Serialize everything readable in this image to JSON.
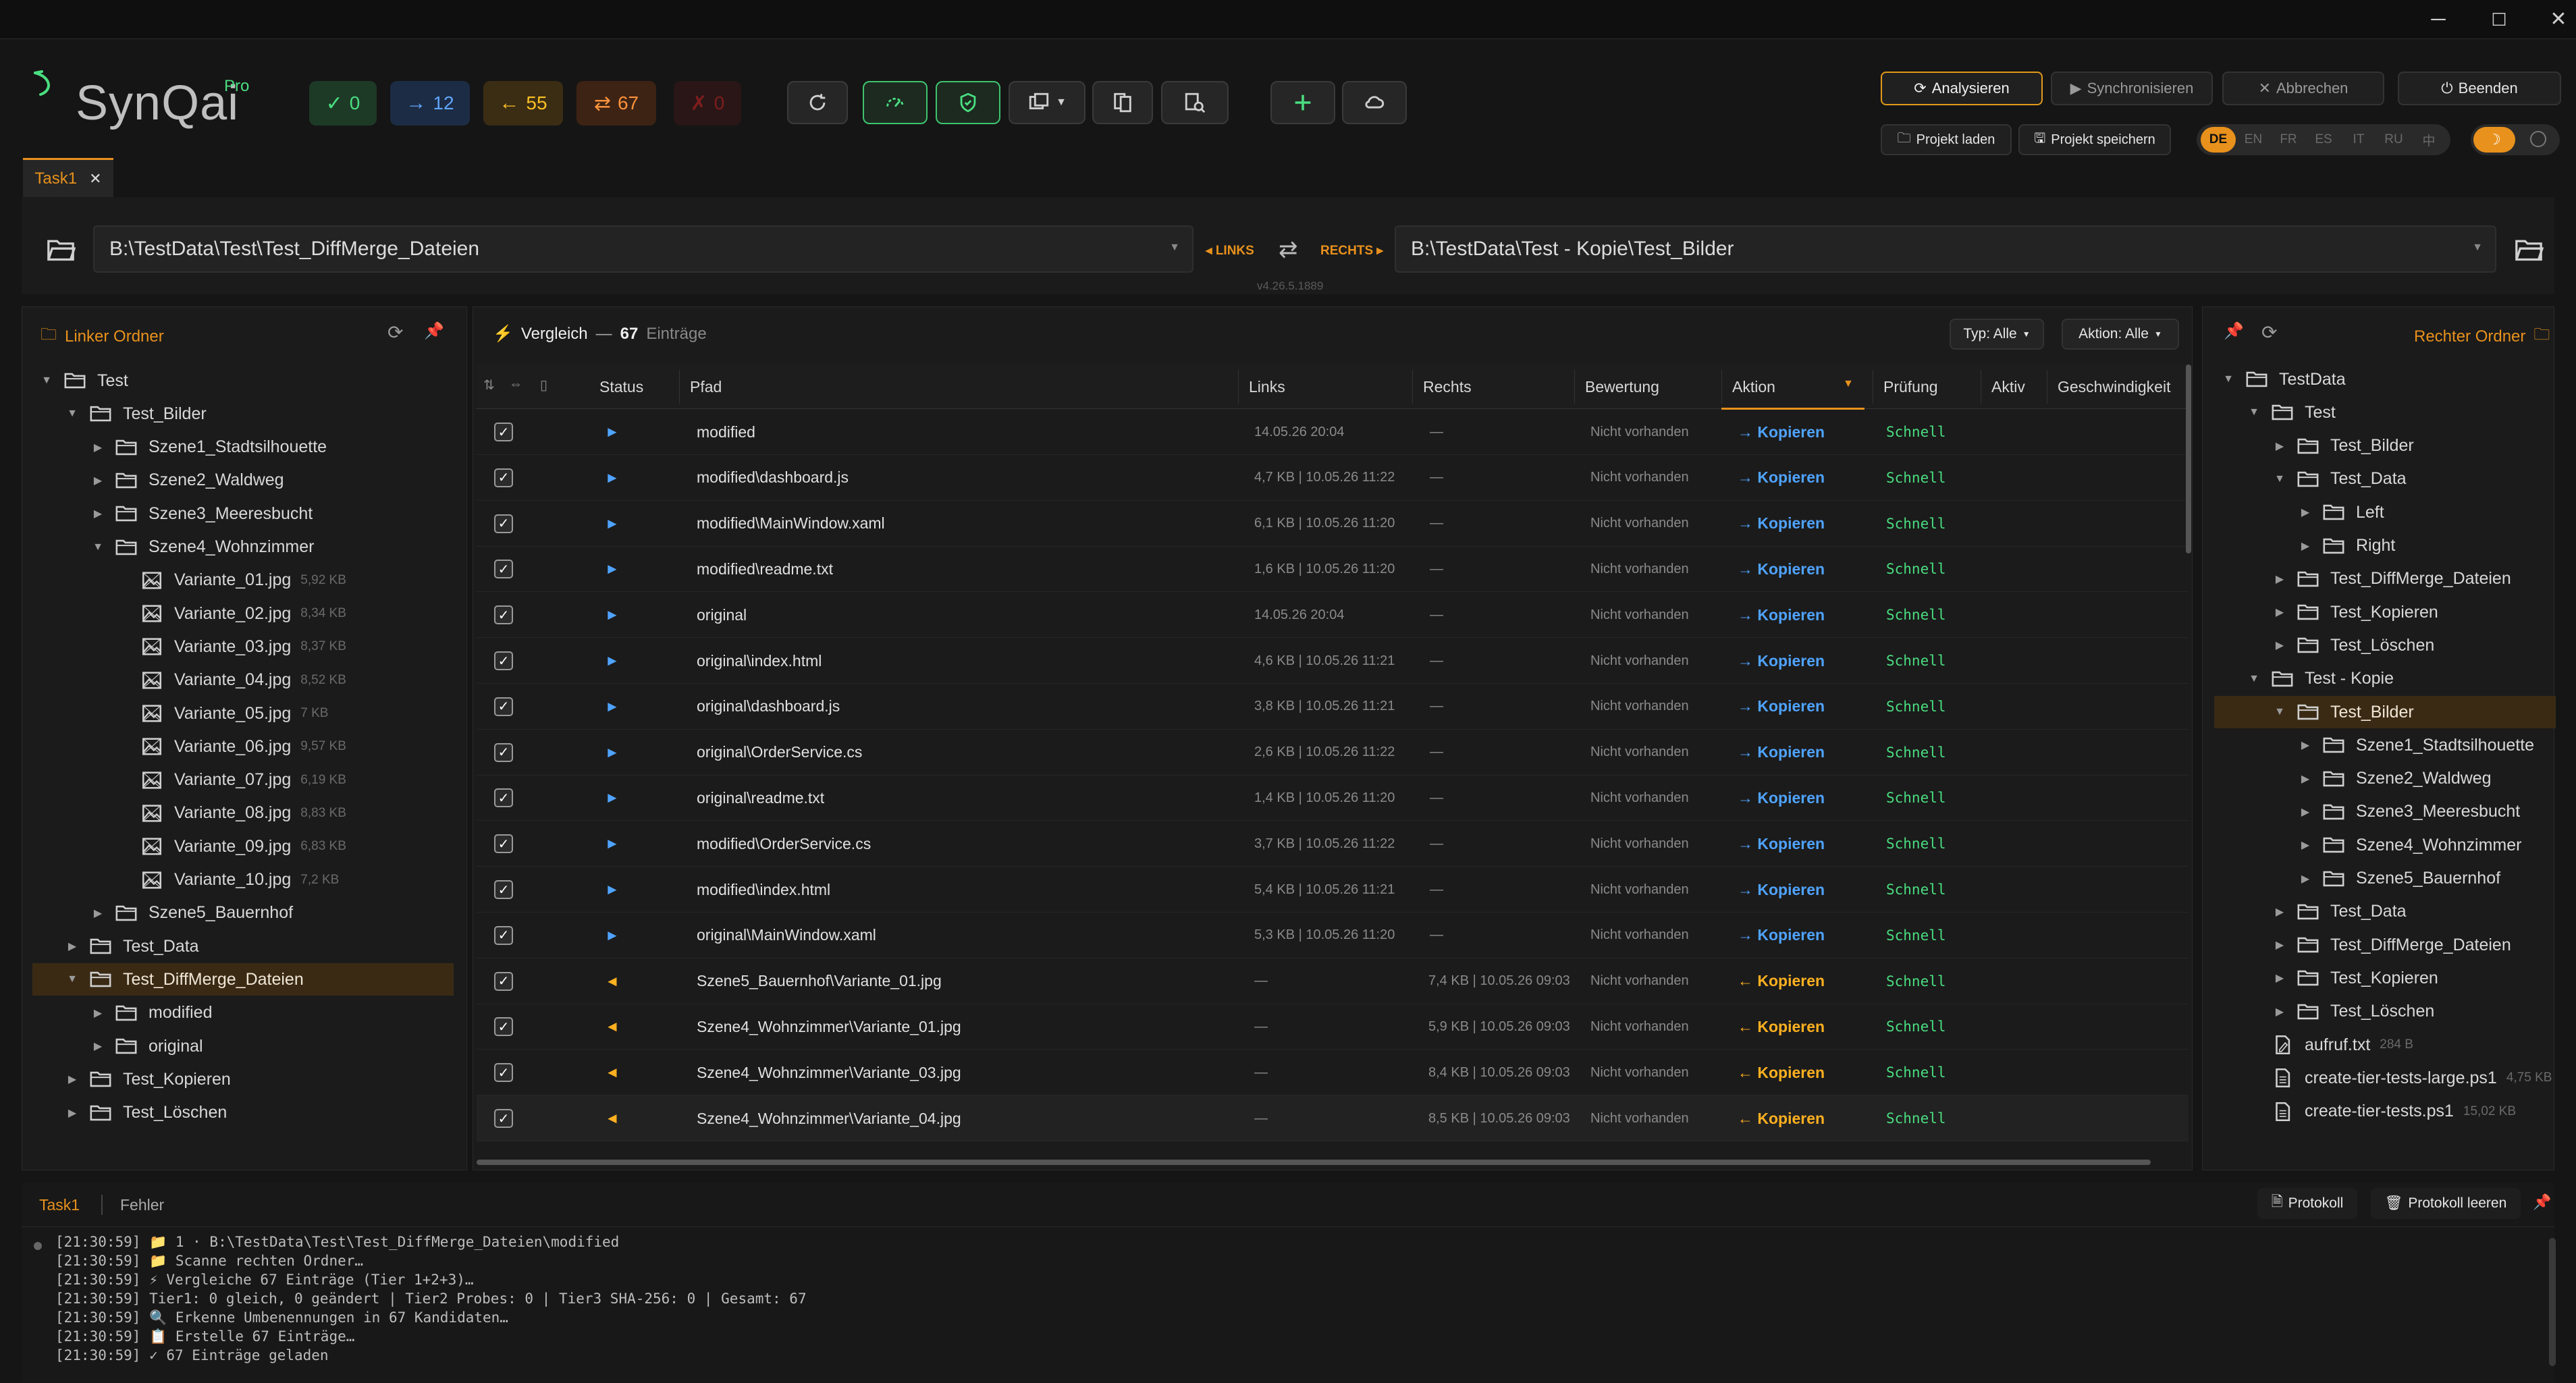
{
  "window": {
    "minimize": "─",
    "maximize": "☐",
    "close": "✕"
  },
  "app": {
    "name": "SynQai",
    "badge": "Pro"
  },
  "counters": [
    {
      "icon": "✓",
      "value": "0",
      "color": "#4ade80",
      "bg": "#1d3a27"
    },
    {
      "icon": "→",
      "value": "12",
      "color": "#60a5fa",
      "bg": "#1c2c44"
    },
    {
      "icon": "←",
      "value": "55",
      "color": "#fbbf24",
      "bg": "#3a2d14"
    },
    {
      "icon": "⇄",
      "value": "67",
      "color": "#fb923c",
      "bg": "#3d2314"
    },
    {
      "icon": "✗",
      "value": "0",
      "color": "#7f1d1d",
      "bg": "#2a1616"
    }
  ],
  "actions": {
    "analyze": "Analysieren",
    "sync": "Synchronisieren",
    "cancel": "Abbrechen",
    "quit": "Beenden",
    "load_project": "Projekt laden",
    "save_project": "Projekt speichern"
  },
  "languages": [
    "DE",
    "EN",
    "FR",
    "ES",
    "IT",
    "RU",
    "中"
  ],
  "active_language": "DE",
  "tab": {
    "label": "Task1",
    "close": "✕"
  },
  "paths": {
    "left": "B:\\TestData\\Test\\Test_DiffMerge_Dateien",
    "right": "B:\\TestData\\Test - Kopie\\Test_Bilder",
    "left_tag": "◂ LINKS",
    "right_tag": "RECHTS ▸",
    "swap": "⇄",
    "version": "v4.26.5.1889"
  },
  "left_panel": {
    "title": "Linker Ordner",
    "tree": [
      {
        "label": "Test",
        "type": "folder",
        "depth": 0,
        "exp": "▼"
      },
      {
        "label": "Test_Bilder",
        "type": "folder",
        "depth": 1,
        "exp": "▼"
      },
      {
        "label": "Szene1_Stadtsilhouette",
        "type": "folder",
        "depth": 2,
        "exp": "▶"
      },
      {
        "label": "Szene2_Waldweg",
        "type": "folder",
        "depth": 2,
        "exp": "▶"
      },
      {
        "label": "Szene3_Meeresbucht",
        "type": "folder",
        "depth": 2,
        "exp": "▶"
      },
      {
        "label": "Szene4_Wohnzimmer",
        "type": "folder",
        "depth": 2,
        "exp": "▼"
      },
      {
        "label": "Variante_01.jpg",
        "type": "image",
        "depth": 3,
        "size": "5,92 KB"
      },
      {
        "label": "Variante_02.jpg",
        "type": "image",
        "depth": 3,
        "size": "8,34 KB"
      },
      {
        "label": "Variante_03.jpg",
        "type": "image",
        "depth": 3,
        "size": "8,37 KB"
      },
      {
        "label": "Variante_04.jpg",
        "type": "image",
        "depth": 3,
        "size": "8,52 KB"
      },
      {
        "label": "Variante_05.jpg",
        "type": "image",
        "depth": 3,
        "size": "7 KB"
      },
      {
        "label": "Variante_06.jpg",
        "type": "image",
        "depth": 3,
        "size": "9,57 KB"
      },
      {
        "label": "Variante_07.jpg",
        "type": "image",
        "depth": 3,
        "size": "6,19 KB"
      },
      {
        "label": "Variante_08.jpg",
        "type": "image",
        "depth": 3,
        "size": "8,83 KB"
      },
      {
        "label": "Variante_09.jpg",
        "type": "image",
        "depth": 3,
        "size": "6,83 KB"
      },
      {
        "label": "Variante_10.jpg",
        "type": "image",
        "depth": 3,
        "size": "7,2 KB"
      },
      {
        "label": "Szene5_Bauernhof",
        "type": "folder",
        "depth": 2,
        "exp": "▶"
      },
      {
        "label": "Test_Data",
        "type": "folder",
        "depth": 1,
        "exp": "▶"
      },
      {
        "label": "Test_DiffMerge_Dateien",
        "type": "folder",
        "depth": 1,
        "exp": "▼",
        "selected": true
      },
      {
        "label": "modified",
        "type": "folder",
        "depth": 2,
        "exp": "▶"
      },
      {
        "label": "original",
        "type": "folder",
        "depth": 2,
        "exp": "▶"
      },
      {
        "label": "Test_Kopieren",
        "type": "folder",
        "depth": 1,
        "exp": "▶"
      },
      {
        "label": "Test_Löschen",
        "type": "folder",
        "depth": 1,
        "exp": "▶"
      }
    ]
  },
  "right_panel": {
    "title": "Rechter Ordner",
    "tree": [
      {
        "label": "TestData",
        "type": "folder",
        "depth": 0,
        "exp": "▼"
      },
      {
        "label": "Test",
        "type": "folder",
        "depth": 1,
        "exp": "▼"
      },
      {
        "label": "Test_Bilder",
        "type": "folder",
        "depth": 2,
        "exp": "▶"
      },
      {
        "label": "Test_Data",
        "type": "folder",
        "depth": 2,
        "exp": "▼"
      },
      {
        "label": "Left",
        "type": "folder",
        "depth": 3,
        "exp": "▶"
      },
      {
        "label": "Right",
        "type": "folder",
        "depth": 3,
        "exp": "▶"
      },
      {
        "label": "Test_DiffMerge_Dateien",
        "type": "folder",
        "depth": 2,
        "exp": "▶"
      },
      {
        "label": "Test_Kopieren",
        "type": "folder",
        "depth": 2,
        "exp": "▶"
      },
      {
        "label": "Test_Löschen",
        "type": "folder",
        "depth": 2,
        "exp": "▶"
      },
      {
        "label": "Test - Kopie",
        "type": "folder",
        "depth": 1,
        "exp": "▼"
      },
      {
        "label": "Test_Bilder",
        "type": "folder",
        "depth": 2,
        "exp": "▼",
        "selected": true
      },
      {
        "label": "Szene1_Stadtsilhouette",
        "type": "folder",
        "depth": 3,
        "exp": "▶"
      },
      {
        "label": "Szene2_Waldweg",
        "type": "folder",
        "depth": 3,
        "exp": "▶"
      },
      {
        "label": "Szene3_Meeresbucht",
        "type": "folder",
        "depth": 3,
        "exp": "▶"
      },
      {
        "label": "Szene4_Wohnzimmer",
        "type": "folder",
        "depth": 3,
        "exp": "▶"
      },
      {
        "label": "Szene5_Bauernhof",
        "type": "folder",
        "depth": 3,
        "exp": "▶"
      },
      {
        "label": "Test_Data",
        "type": "folder",
        "depth": 2,
        "exp": "▶"
      },
      {
        "label": "Test_DiffMerge_Dateien",
        "type": "folder",
        "depth": 2,
        "exp": "▶"
      },
      {
        "label": "Test_Kopieren",
        "type": "folder",
        "depth": 2,
        "exp": "▶"
      },
      {
        "label": "Test_Löschen",
        "type": "folder",
        "depth": 2,
        "exp": "▶"
      },
      {
        "label": "aufruf.txt",
        "type": "edit",
        "depth": 1,
        "size": "284 B"
      },
      {
        "label": "create-tier-tests-large.ps1",
        "type": "file",
        "depth": 1,
        "size": "4,75 KB"
      },
      {
        "label": "create-tier-tests.ps1",
        "type": "file",
        "depth": 1,
        "size": "15,02 KB"
      }
    ]
  },
  "comparison": {
    "title": "Vergleich",
    "dash": "—",
    "count": "67",
    "count_label": "Einträge",
    "filter_type": "Typ: Alle",
    "filter_action": "Aktion: Alle",
    "columns": [
      "Status",
      "Pfad",
      "Links",
      "Rechts",
      "Bewertung",
      "Aktion",
      "Prüfung",
      "Aktiv",
      "Geschwindigkeit"
    ],
    "rows": [
      {
        "dir": "r",
        "path": "modified",
        "left": "14.05.26 20:04",
        "right": "—",
        "rating": "Nicht vorhanden",
        "action": "→ Kopieren",
        "check": "Schnell"
      },
      {
        "dir": "r",
        "path": "modified\\dashboard.js",
        "left": "4,7 KB | 10.05.26 11:22",
        "right": "—",
        "rating": "Nicht vorhanden",
        "action": "→ Kopieren",
        "check": "Schnell"
      },
      {
        "dir": "r",
        "path": "modified\\MainWindow.xaml",
        "left": "6,1 KB | 10.05.26 11:20",
        "right": "—",
        "rating": "Nicht vorhanden",
        "action": "→ Kopieren",
        "check": "Schnell"
      },
      {
        "dir": "r",
        "path": "modified\\readme.txt",
        "left": "1,6 KB | 10.05.26 11:20",
        "right": "—",
        "rating": "Nicht vorhanden",
        "action": "→ Kopieren",
        "check": "Schnell"
      },
      {
        "dir": "r",
        "path": "original",
        "left": "14.05.26 20:04",
        "right": "—",
        "rating": "Nicht vorhanden",
        "action": "→ Kopieren",
        "check": "Schnell"
      },
      {
        "dir": "r",
        "path": "original\\index.html",
        "left": "4,6 KB | 10.05.26 11:21",
        "right": "—",
        "rating": "Nicht vorhanden",
        "action": "→ Kopieren",
        "check": "Schnell"
      },
      {
        "dir": "r",
        "path": "original\\dashboard.js",
        "left": "3,8 KB | 10.05.26 11:21",
        "right": "—",
        "rating": "Nicht vorhanden",
        "action": "→ Kopieren",
        "check": "Schnell"
      },
      {
        "dir": "r",
        "path": "original\\OrderService.cs",
        "left": "2,6 KB | 10.05.26 11:22",
        "right": "—",
        "rating": "Nicht vorhanden",
        "action": "→ Kopieren",
        "check": "Schnell"
      },
      {
        "dir": "r",
        "path": "original\\readme.txt",
        "left": "1,4 KB | 10.05.26 11:20",
        "right": "—",
        "rating": "Nicht vorhanden",
        "action": "→ Kopieren",
        "check": "Schnell"
      },
      {
        "dir": "r",
        "path": "modified\\OrderService.cs",
        "left": "3,7 KB | 10.05.26 11:22",
        "right": "—",
        "rating": "Nicht vorhanden",
        "action": "→ Kopieren",
        "check": "Schnell"
      },
      {
        "dir": "r",
        "path": "modified\\index.html",
        "left": "5,4 KB | 10.05.26 11:21",
        "right": "—",
        "rating": "Nicht vorhanden",
        "action": "→ Kopieren",
        "check": "Schnell"
      },
      {
        "dir": "r",
        "path": "original\\MainWindow.xaml",
        "left": "5,3 KB | 10.05.26 11:20",
        "right": "—",
        "rating": "Nicht vorhanden",
        "action": "→ Kopieren",
        "check": "Schnell"
      },
      {
        "dir": "l",
        "path": "Szene5_Bauernhof\\Variante_01.jpg",
        "left": "—",
        "right": "7,4 KB | 10.05.26 09:03",
        "rating": "Nicht vorhanden",
        "action": "← Kopieren",
        "check": "Schnell"
      },
      {
        "dir": "l",
        "path": "Szene4_Wohnzimmer\\Variante_01.jpg",
        "left": "—",
        "right": "5,9 KB | 10.05.26 09:03",
        "rating": "Nicht vorhanden",
        "action": "← Kopieren",
        "check": "Schnell"
      },
      {
        "dir": "l",
        "path": "Szene4_Wohnzimmer\\Variante_03.jpg",
        "left": "—",
        "right": "8,4 KB | 10.05.26 09:03",
        "rating": "Nicht vorhanden",
        "action": "← Kopieren",
        "check": "Schnell"
      },
      {
        "dir": "l",
        "path": "Szene4_Wohnzimmer\\Variante_04.jpg",
        "left": "—",
        "right": "8,5 KB | 10.05.26 09:03",
        "rating": "Nicht vorhanden",
        "action": "← Kopieren",
        "check": "Schnell"
      }
    ]
  },
  "bottom": {
    "tabs": [
      "Task1",
      "Fehler"
    ],
    "protocol": "Protokoll",
    "clear_protocol": "Protokoll leeren",
    "log": [
      "[21:30:59] 📁 1 · B:\\TestData\\Test\\Test_DiffMerge_Dateien\\modified",
      "[21:30:59] 📁 Scanne rechten Ordner…",
      "[21:30:59] ⚡ Vergleiche 67 Einträge (Tier 1+2+3)…",
      "[21:30:59] Tier1: 0 gleich, 0 geändert | Tier2 Probes: 0 | Tier3 SHA-256: 0 | Gesamt: 67",
      "[21:30:59] 🔍 Erkenne Umbenennungen in 67 Kandidaten…",
      "[21:30:59] 📋 Erstelle 67 Einträge…",
      "[21:30:59] ✓ 67 Einträge geladen"
    ]
  },
  "colors": {
    "accent": "#e8911c",
    "green": "#4ade80",
    "blue": "#4fa3ff",
    "orange": "#ffb020"
  }
}
